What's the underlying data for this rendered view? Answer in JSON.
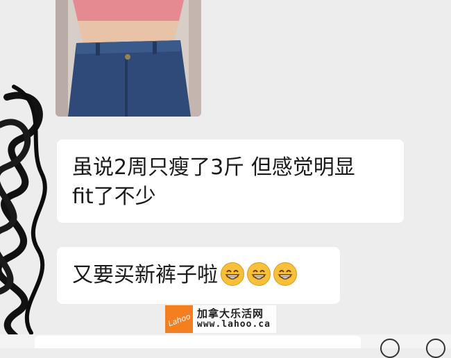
{
  "chat": {
    "messages": [
      {
        "type": "image",
        "description_icon": "photo-torso-jeans"
      },
      {
        "type": "text",
        "lines": [
          "虽说2周只瘦了3斤 但感觉明显",
          "fit了不少"
        ]
      },
      {
        "type": "text",
        "text": "又要买新裤子啦",
        "emojis": [
          "grinning-face-icon",
          "grinning-face-icon",
          "grinning-face-icon"
        ]
      }
    ]
  },
  "watermark": {
    "logo_text": "Lahoo",
    "name": "加拿大乐活网",
    "url": "www.lahoo.ca"
  },
  "colors": {
    "background": "#ededed",
    "bubble": "#ffffff",
    "emoji": "#f6c03a",
    "watermark_logo": "#f47f20"
  }
}
